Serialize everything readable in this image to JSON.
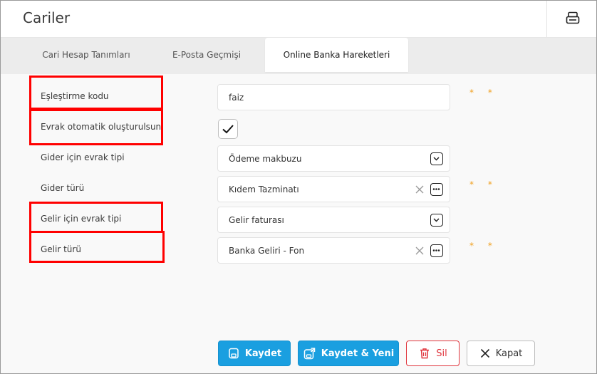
{
  "window": {
    "title": "Cariler",
    "header_icon": "printer-icon"
  },
  "tabs": [
    {
      "label": "Cari Hesap Tanımları",
      "active": false
    },
    {
      "label": "E-Posta Geçmişi",
      "active": false
    },
    {
      "label": "Online Banka Hareketleri",
      "active": true
    }
  ],
  "form": {
    "matching_code": {
      "label": "Eşleştirme kodu",
      "value": "faiz",
      "required_mark": "* *"
    },
    "auto_create_doc": {
      "label": "Evrak otomatik oluşturulsun",
      "checked": true
    },
    "expense_doc_type": {
      "label": "Gider için evrak tipi",
      "value": "Ödeme makbuzu"
    },
    "expense_type": {
      "label": "Gider türü",
      "value": "Kıdem Tazminatı",
      "required_mark": "* *"
    },
    "income_doc_type": {
      "label": "Gelir için evrak tipi",
      "value": "Gelir faturası"
    },
    "income_type": {
      "label": "Gelir türü",
      "value": "Banka Geliri - Fon",
      "required_mark": "* *"
    }
  },
  "buttons": {
    "save": "Kaydet",
    "save_new": "Kaydet & Yeni",
    "delete": "Sil",
    "close": "Kapat"
  },
  "colors": {
    "primary": "#1a9fe0",
    "danger": "#e0343c",
    "highlight": "#ff0000",
    "required": "#f0a020"
  }
}
